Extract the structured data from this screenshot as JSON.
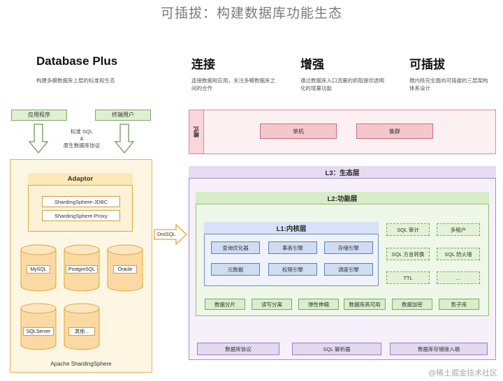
{
  "title": "可插拔：构建数据库功能生态",
  "columns": [
    {
      "heading": "Database Plus",
      "desc": "构建多模数据库上层的标准和生态"
    },
    {
      "heading": "连接",
      "desc": "连接数据和应用，关注多模数据库之间的合作"
    },
    {
      "heading": "增强",
      "desc": "通过数据库入口流量的抓取提供透明化的增量功能"
    },
    {
      "heading": "可插拔",
      "desc": "微内核完全面向可插拔的三层架构体系设计"
    }
  ],
  "left": {
    "app": "应用程序",
    "user": "终端用户",
    "protocol_line1": "标准 SQL",
    "protocol_line2": "&",
    "protocol_line3": "原生数据库协议",
    "adaptor_title": "Adaptor",
    "jdbc": "ShardingSphere-JDBC",
    "proxy": "ShardingSphere-Proxy",
    "dbs": [
      "MySQL",
      "PostgreSQL",
      "Oracle",
      "SQLServer",
      "其他..."
    ],
    "footer": "Apache ShardingSphere",
    "arrow_label": "DistSQL"
  },
  "mode": {
    "label": "模式",
    "items": [
      "单机",
      "集群"
    ]
  },
  "l3": {
    "title": "L3：生态层",
    "bottom": [
      "数据库协议",
      "SQL 解析器",
      "数据库存储接入端"
    ]
  },
  "l2": {
    "title": "L2:功能层",
    "right_boxes": [
      "SQL 审计",
      "多租户",
      "SQL 方言转换",
      "SQL 防火墙",
      "TTL",
      "..."
    ],
    "bottom_row": [
      "数据分片",
      "读写分离",
      "弹性伸缩",
      "数据库高可用",
      "数据加密",
      "影子库"
    ]
  },
  "l1": {
    "title": "L1:内核层",
    "boxes": [
      "查询优化器",
      "事务引擎",
      "存储引擎",
      "元数据",
      "权限引擎",
      "调度引擎"
    ]
  },
  "watermark": "@稀土掘金技术社区",
  "colors": {
    "yellow": "#fdf6e3",
    "pink": "#f6c6cd",
    "purple": "#e5dcf1",
    "green": "#d7ecc8",
    "blue": "#cfdcf2"
  }
}
